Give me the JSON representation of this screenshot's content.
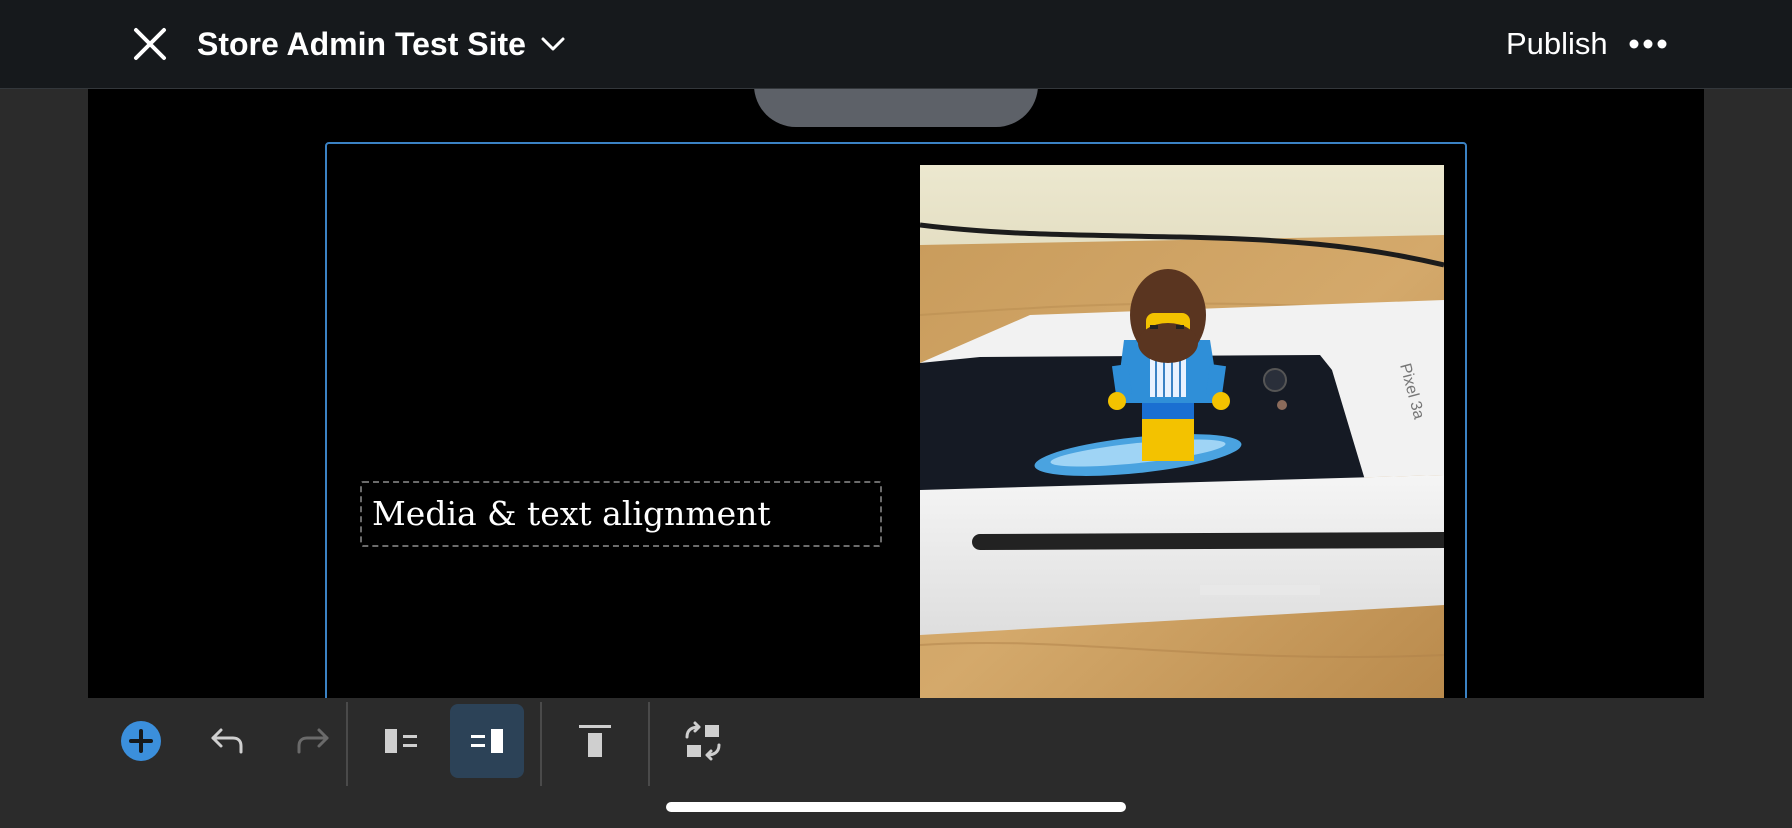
{
  "header": {
    "title": "Store Admin Test Site",
    "publish_label": "Publish",
    "icons": [
      "close-icon",
      "chevron-down-icon",
      "more-icon"
    ]
  },
  "editor": {
    "block_text": "Media & text alignment",
    "image_label": "Pixel 3a",
    "accent_color": "#3b82c4"
  },
  "toolbar": {
    "items": [
      "add-block-icon",
      "undo-icon",
      "redo-icon",
      "media-left-icon",
      "media-right-icon",
      "align-top-icon",
      "swap-icon"
    ],
    "active_item": "media-right-icon",
    "redo_enabled": false
  }
}
